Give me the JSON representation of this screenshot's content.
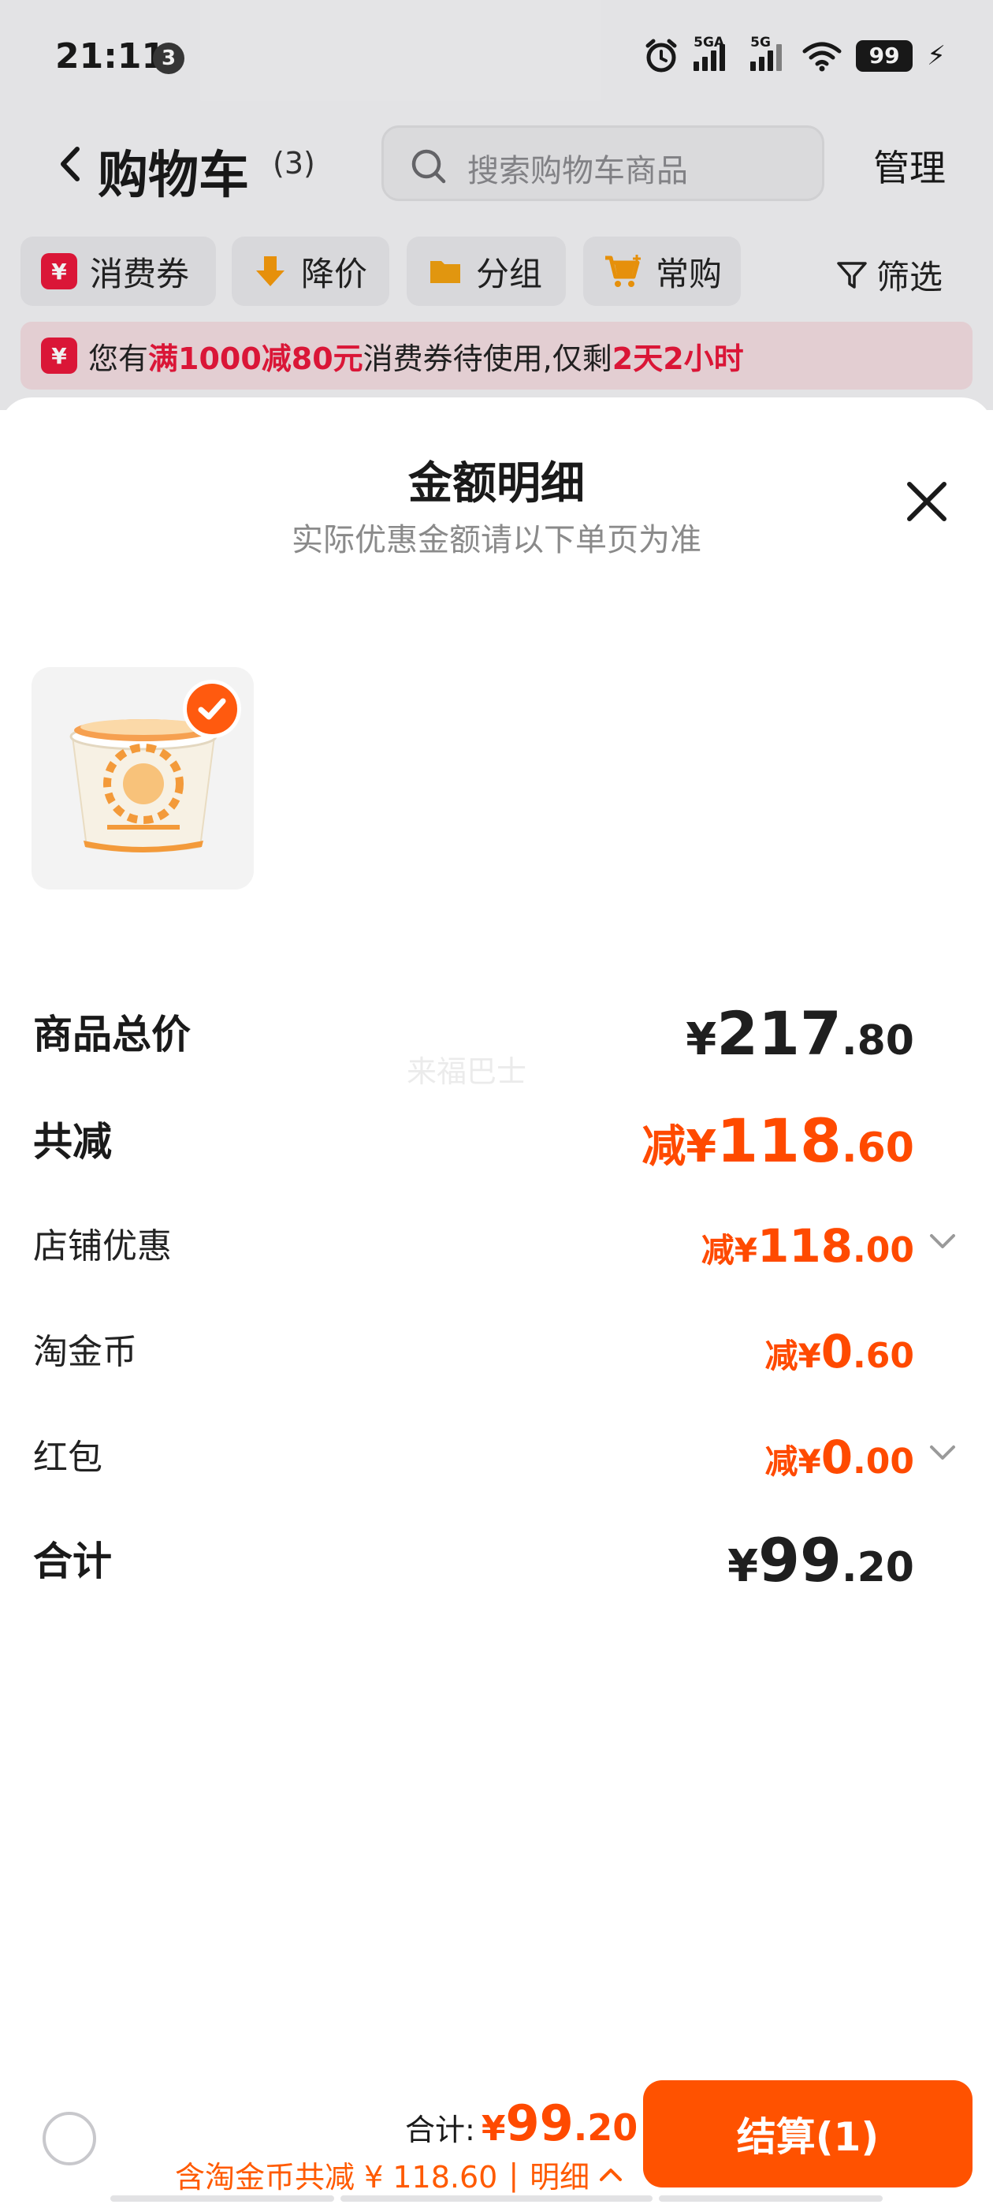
{
  "status_bar": {
    "time": "21:11",
    "notification_count": "3",
    "signal1_label": "5GA",
    "signal2_label": "5G",
    "battery": "99"
  },
  "nav": {
    "title": "购物车",
    "count": "(3)",
    "search_placeholder": "搜索购物车商品",
    "manage": "管理"
  },
  "chips": [
    {
      "label": "消费券",
      "icon": "yuan-coupon-icon",
      "color": "#e8183b"
    },
    {
      "label": "降价",
      "icon": "price-drop-icon",
      "color": "#f59a0c"
    },
    {
      "label": "分组",
      "icon": "folder-icon",
      "color": "#f0a010"
    },
    {
      "label": "常购",
      "icon": "cart-plus-icon",
      "color": "#f59a0c"
    }
  ],
  "filter_label": "筛选",
  "promo": {
    "prefix": "您有",
    "highlight1": "满1000减80元",
    "middle": "消费券待使用,仅剩",
    "highlight2": "2天2小时"
  },
  "sheet": {
    "title": "金额明细",
    "subtitle": "实际优惠金额请以下单页为准",
    "watermark": "来福巴士"
  },
  "breakdown": {
    "subtotal": {
      "label": "商品总价",
      "currency": "¥",
      "integer": "217",
      "decimal": ".80"
    },
    "total_discount": {
      "label": "共减",
      "prefix": "减",
      "currency": "¥",
      "integer": "118",
      "decimal": ".60"
    },
    "shop_discount": {
      "label": "店铺优惠",
      "prefix": "减",
      "currency": "¥",
      "integer": "118",
      "decimal": ".00"
    },
    "taojinbi": {
      "label": "淘金币",
      "prefix": "减",
      "currency": "¥",
      "integer": "0",
      "decimal": ".60"
    },
    "red_packet": {
      "label": "红包",
      "prefix": "减",
      "currency": "¥",
      "integer": "0",
      "decimal": ".00"
    },
    "grand_total": {
      "label": "合计",
      "currency": "¥",
      "integer": "99",
      "decimal": ".20"
    }
  },
  "bottom_bar": {
    "total_label": "合计:",
    "currency": "¥",
    "integer": "99",
    "decimal": ".20",
    "discount_text": "含淘金币共减 ¥ 118.60",
    "separator": "|",
    "detail_label": "明细",
    "checkout_label": "结算(1)"
  },
  "colors": {
    "accent_orange": "#ff5200",
    "discount_orange": "#ff4a00",
    "promo_red": "#e8183b"
  }
}
